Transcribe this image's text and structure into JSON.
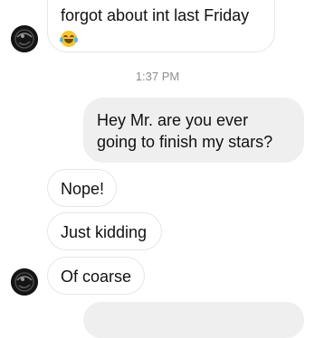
{
  "messages": [
    {
      "text": "forgot about int last Friday",
      "emoji": "tears-of-joy"
    },
    {
      "text": "1:37 PM"
    },
    {
      "text": "Hey Mr. are you ever going to finish my stars?"
    },
    {
      "text": "Nope!"
    },
    {
      "text": "Just kidding"
    },
    {
      "text": "Of coarse"
    }
  ],
  "colors": {
    "received_border": "#e6e6e6",
    "sent_background": "#efefef",
    "timestamp": "#8e8e8e"
  }
}
